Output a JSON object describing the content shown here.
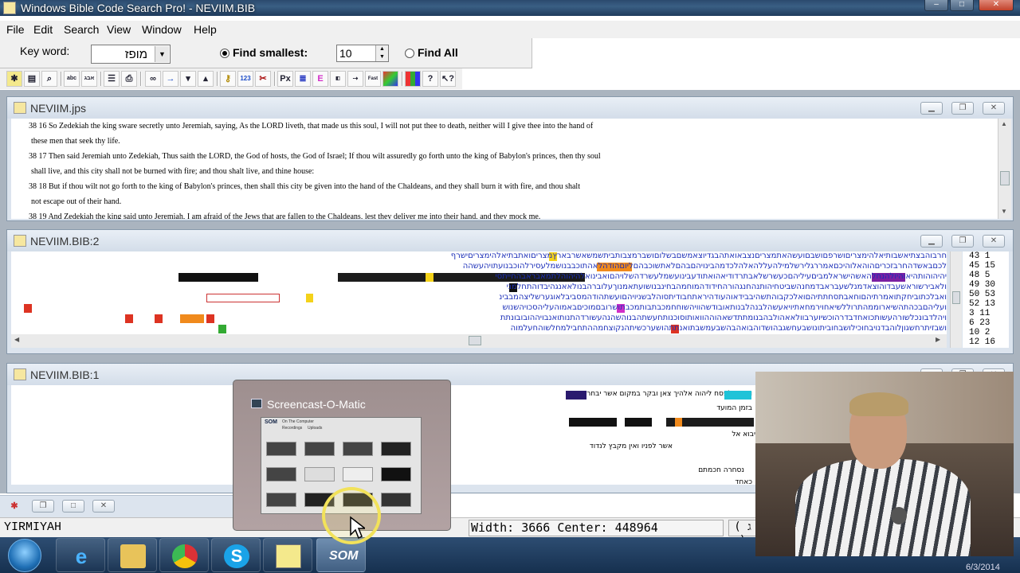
{
  "app": {
    "title": "Windows Bible Code Search Pro! - NEVIIM.BIB",
    "window_buttons": [
      "–",
      "□",
      "✕"
    ]
  },
  "menu": [
    "File",
    "Edit",
    "Search",
    "View",
    "Window",
    "Help"
  ],
  "search": {
    "keyword_label": "Key word:",
    "keyword_value": "מופז",
    "find_smallest_label": "Find smallest:",
    "find_smallest_value": "10",
    "find_smallest_selected": true,
    "find_all_label": "Find All"
  },
  "toolbar": {
    "buttons": [
      "new-icon",
      "open-icon",
      "search-icon",
      "text-icon",
      "hebrew-icon",
      "list-icon",
      "print-icon",
      "binoculars-icon",
      "arrow-right-icon",
      "arrow-down-icon",
      "arrow-up-icon",
      "key-icon",
      "numbers-icon",
      "tools-icon",
      "px-icon",
      "lines-icon",
      "e-icon",
      "autofind-icon",
      "skip-icon",
      "fast-icon",
      "color-icon",
      "chart-icon",
      "help-icon",
      "context-help-icon"
    ],
    "labels": {
      "px": "Px",
      "e": "E",
      "fast": "Fast"
    }
  },
  "windows": {
    "text": {
      "title": "NEVIIM.jps",
      "lines": [
        "38 16 So Zedekiah the king sware secretly unto Jeremiah, saying, As the LORD liveth, that made us this soul, I will not put thee to death, neither will I give thee into the hand of",
        "these men that seek thy life.",
        "38 17 Then said Jeremiah unto Zedekiah, Thus saith the LORD, the God of hosts, the God of Israel; If thou wilt assuredly go forth unto the king of Babylon's princes, then thy soul",
        "shall live, and this city shall not be burned with fire; and thou shalt live, and thine house:",
        "38 18 But if thou wilt not go forth to the king of Babylon's princes, then shall this city be given into the hand of the Chaldeans, and they shall burn it with fire, and thou shalt",
        "not escape out of their hand.",
        "38 19 And Zedekiah the king said unto Jeremiah, I am afraid of the Jews that are fallen to the Chaldeans, lest they deliver me into their hand, and they mock me."
      ]
    },
    "grid": {
      "title": "NEVIIM.BIB:2",
      "rows": [
        "חרבוהבצתיאשבותיאלהימצריםושרפםושבםועשהאתמצריםנצבאואתהבגדיוצאמשםבשלוםושברמצבותביתשמשאשרבארץמצריםואתבתיאלהימצריםישרף",
        "לכםבאשדהחרבזכריםהוהאלוהיכםאמררגלירשלמילהעללהאלהלכדמהבינויהםבהםלאתשוכבהםליוםהודהלאהתוכבבנושמלעסירלהוכבנועתויהעשהה",
        "יהיהוהותהיאוהיולהנחלהאשהישראלמביםעיליהםכעשרשלאבתרדודיאהואתודעבינועשמלעשרדהשלויהםואבינואלהיהוהלתמאבראבהחייתסי",
        "ולאבירשוראשעבדוהוצאדמנלשעבראבדמחנהשביטחיהותנהחנגהורהחידודהמוחמהבחינבנושועתאמנוךעלוברהבנולאאנגהיבדוהתחלמני",
        "ואבלכתוביחקתואמרתיהםוחאבתסחתתיהםואלכקבוהתשהיבבידאוהעודהיראתחבודיתסוהלבשניויהםועשתהודהמסביבלאוגערשליצהמבבינ",
        "ועליהםבכהתהשיארוממהתרוללשיאחוירמחאתיויאעשהלבנהלבנותאובודשהוויהשוחחמכבתבותמכבתושרובםמוכיםבאמוהעליהסכויהשנוש",
        "ויהלדבונכלשורהעשותכואחדבדרהוכשיוערבוולאאהולבהבנומתתדשאהוההוואותוסוכנותחעשתהבנוהשהנהעשורדהתנותואנבויההובובונתת",
        "ושבזיתרחשגוןלוהבדנויבחוכילושבחוביתונושבעחשגבהושדוהבואהבהשבעמשבתואנתתהושערכשיתהנקוצחמההתחבילמחלשוהחעלמוה"
      ],
      "counts": [
        "43 1",
        "45 15",
        "48 5",
        "49 30",
        "50 53",
        "52 13",
        "3 11",
        "6 23",
        "10 2",
        "12 16"
      ]
    },
    "hebrew": {
      "title": "NEVIIM.BIB:1",
      "lines": [
        "וזבחת לפסח ליהוה אלהיך צאן ובקר במקום אשר יבחר",
        "בזמן המועד",
        "יבוא אל",
        "אשר לפניו ואין מקבץ לנדוד",
        "נסחרה חכמתם",
        "כאחד"
      ]
    }
  },
  "status": {
    "book": "YIRMIYAH",
    "width_center": "Width: 3666 Center: 448964",
    "paren": "( ג )"
  },
  "popup": {
    "title": "Screencast-O-Matic",
    "inner_title": "On The Computer",
    "inner_tabs": [
      "Recordings",
      "Uploads"
    ]
  },
  "taskbar": {
    "date": "6/3/2014",
    "apps": [
      "ie-icon",
      "explorer-icon",
      "chrome-icon",
      "skype-icon",
      "biblecode-icon",
      "screencast-icon"
    ],
    "screencast_label": "SOM"
  }
}
